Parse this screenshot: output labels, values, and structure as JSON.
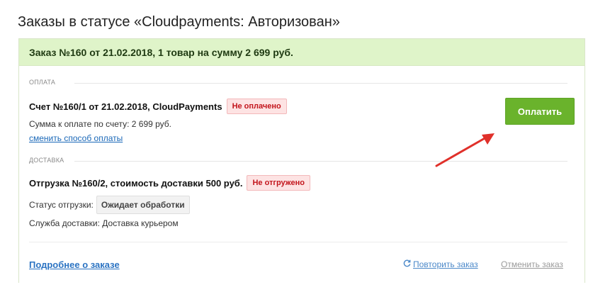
{
  "page": {
    "title": "Заказы в статусе «Cloudpayments: Авторизован»"
  },
  "order": {
    "header": "Заказ №160 от 21.02.2018, 1 товар на сумму 2 699 руб.",
    "payment_section": {
      "label": "ОПЛАТА",
      "invoice_title": "Счет №160/1 от 21.02.2018, CloudPayments",
      "status_badge": "Не оплачено",
      "amount_text": "Сумма к оплате по счету: 2 699 руб.",
      "change_method_link": "сменить способ оплаты",
      "pay_button": "Оплатить"
    },
    "delivery_section": {
      "label": "ДОСТАВКА",
      "shipment_title": "Отгрузка №160/2, стоимость доставки 500 руб.",
      "status_badge": "Не отгружено",
      "shipment_status_label": "Статус отгрузки:",
      "shipment_status_value": "Ожидает обработки",
      "delivery_service_text": "Служба доставки: Доставка курьером"
    },
    "footer": {
      "details_link": "Подробнее о заказе",
      "repeat_link": "Повторить заказ",
      "cancel_link": "Отменить заказ"
    }
  },
  "colors": {
    "header_bg": "#dff4c9",
    "pay_button": "#6ab32c",
    "badge_red": "#c3151c",
    "link_blue": "#1a68b8",
    "annotation_arrow": "#e0302a"
  },
  "icons": {
    "repeat": "refresh-icon",
    "annotation": "red-arrow"
  }
}
